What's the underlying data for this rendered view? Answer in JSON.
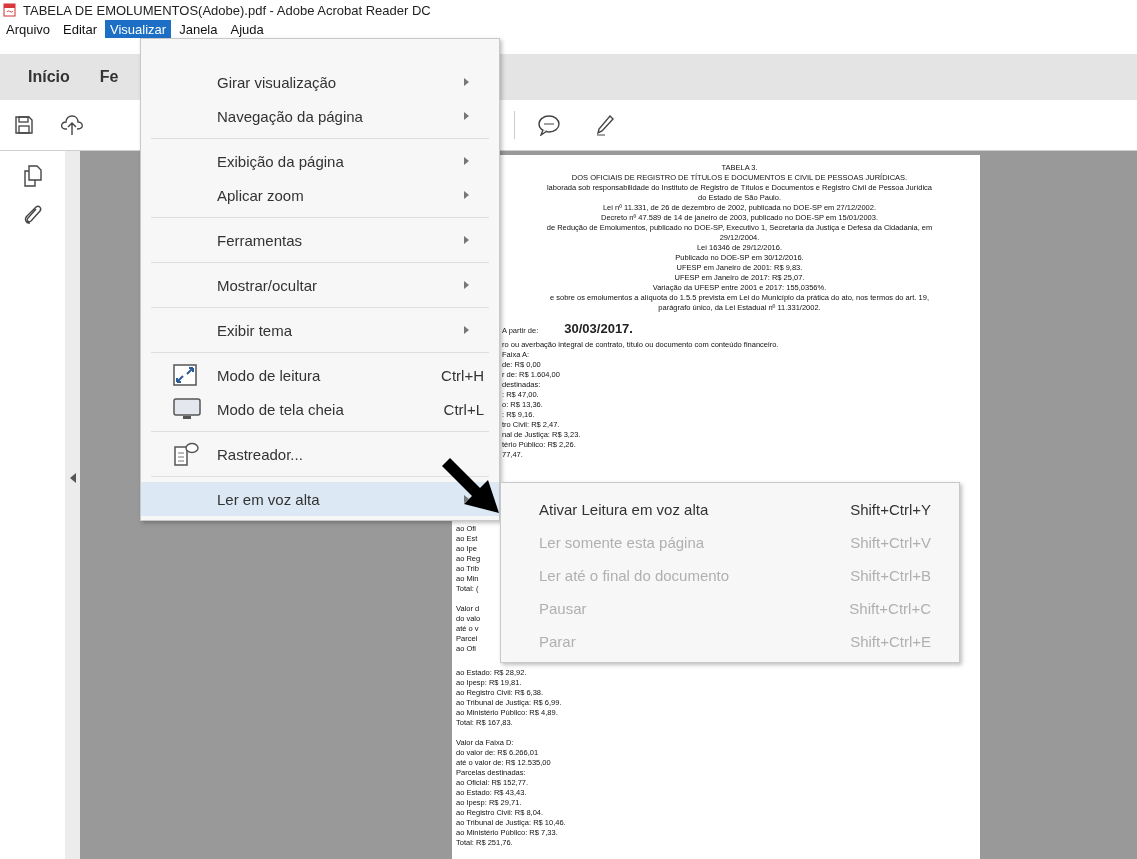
{
  "window": {
    "title": "TABELA DE EMOLUMENTOS(Adobe).pdf - Adobe Acrobat Reader DC"
  },
  "menu_bar": [
    {
      "label": "Arquivo",
      "selected": false
    },
    {
      "label": "Editar",
      "selected": false
    },
    {
      "label": "Visualizar",
      "selected": true
    },
    {
      "label": "Janela",
      "selected": false
    },
    {
      "label": "Ajuda",
      "selected": false
    }
  ],
  "tabs": [
    {
      "label": "Início"
    },
    {
      "label": "Fe"
    }
  ],
  "view_menu": {
    "groups": [
      {
        "items": [
          {
            "label": "Girar visualização",
            "kind": "submenu",
            "selected": false
          },
          {
            "label": "Navegação da página",
            "kind": "submenu",
            "selected": false
          }
        ]
      },
      {
        "items": [
          {
            "label": "Exibição da página",
            "kind": "submenu",
            "selected": false
          },
          {
            "label": "Aplicar zoom",
            "kind": "submenu",
            "selected": false
          }
        ]
      },
      {
        "items": [
          {
            "label": "Ferramentas",
            "kind": "submenu",
            "selected": false
          }
        ]
      },
      {
        "items": [
          {
            "label": "Mostrar/ocultar",
            "kind": "submenu",
            "selected": false
          }
        ]
      },
      {
        "items": [
          {
            "label": "Exibir tema",
            "kind": "submenu",
            "selected": false
          }
        ]
      },
      {
        "items": [
          {
            "label": "Modo de leitura",
            "kind": "command",
            "shortcut": "Ctrl+H",
            "selected": false
          },
          {
            "label": "Modo de tela cheia",
            "kind": "command",
            "shortcut": "Ctrl+L",
            "selected": false
          }
        ]
      },
      {
        "items": [
          {
            "label": "Rastreador...",
            "kind": "command",
            "selected": false
          }
        ]
      },
      {
        "items": [
          {
            "label": "Ler em voz alta",
            "kind": "submenu",
            "selected": true
          }
        ]
      }
    ]
  },
  "read_aloud_submenu": [
    {
      "label": "Ativar Leitura em voz alta",
      "shortcut": "Shift+Ctrl+Y",
      "disabled": false
    },
    {
      "label": "Ler somente esta página",
      "shortcut": "Shift+Ctrl+V",
      "disabled": true
    },
    {
      "label": "Ler até o final do documento",
      "shortcut": "Shift+Ctrl+B",
      "disabled": true
    },
    {
      "label": "Pausar",
      "shortcut": "Shift+Ctrl+C",
      "disabled": true
    },
    {
      "label": "Parar",
      "shortcut": "Shift+Ctrl+E",
      "disabled": true
    }
  ],
  "document_page": {
    "header_lines": [
      "TABELA 3.",
      "DOS OFICIAIS DE REGISTRO DE TÍTULOS E DOCUMENTOS E CIVIL DE PESSOAS JURÍDICAS.",
      "laborada sob responsabilidade do Instituto de Registro de Títulos e Documentos e Registro Civil de Pessoa Jurídica",
      "do Estado de São Paulo.",
      "Lei nº 11.331, de 26 de dezembro de 2002, publicada no DOE-SP em 27/12/2002.",
      "Decreto nº 47.589 de 14 de janeiro de 2003, publicado no DOE-SP em 15/01/2003.",
      "de Redução de Emolumentos, publicado no DOE-SP, Executivo 1, Secretaria da Justiça e Defesa da Cidadania, em",
      "29/12/2004.",
      "Lei 16346 de 29/12/2016.",
      "Publicado no DOE-SP em 30/12/2016.",
      "UFESP em Janeiro de 2001: R$ 9,83.",
      "UFESP em Janeiro de 2017: R$ 25,07.",
      "Variação da UFESP entre 2001 e 2017: 155,0356%.",
      "e sobre os emolumentos a alíquota do 1.5.5 prevista em Lei do Município da prática do ato, nos termos do art. 19,",
      "parágrafo único, da Lei Estadual nº 11.331/2002."
    ],
    "effective_label": "A partir de:",
    "effective_date": "30/03/2017.",
    "body_lines": [
      "ro ou averbação integral de contrato, título ou documento com conteúdo financeiro.",
      "Faixa A:",
      "de: R$ 0,00",
      "r de: R$ 1.604,00",
      "destinadas:",
      ": R$ 47,00.",
      "o: R$ 13,36.",
      ": R$ 9,16.",
      "tro Civil: R$ 2,47.",
      "nal de Justiça: R$ 3,23.",
      "tério Público: R$ 2,26.",
      "77,47."
    ],
    "partial_blocks": [
      {
        "lines": [
          "ao Ofi",
          "ao Est",
          "ao Ipe",
          "ao Reg",
          "ao Trib",
          "ao Min",
          "Total: ("
        ]
      },
      {
        "lines": [
          "Valor d",
          "do valo",
          "até o v",
          "Parcel",
          "ao Ofi"
        ]
      }
    ],
    "lower_blocks": [
      {
        "lines": [
          "ao Estado: R$ 28,92.",
          "ao Ipesp: R$ 19,81.",
          "ao Registro Civil: R$ 6,38.",
          "ao Tribunal de Justiça: R$ 6,99.",
          "ao Ministério Público: R$ 4,89.",
          "Total: R$ 167,83."
        ]
      },
      {
        "lines": [
          "Valor da Faixa D:",
          "do valor de: R$ 6.266,01",
          "até o valor de: R$ 12.535,00",
          "Parcelas destinadas:",
          "ao Oficial: R$ 152,77.",
          "ao Estado: R$ 43,43.",
          "ao Ipesp: R$ 29,71.",
          "ao Registro Civil: R$ 8,04.",
          "ao Tribunal de Justiça: R$ 10,46.",
          "ao Ministério Público: R$ 7,33.",
          "Total: R$ 251,76."
        ]
      }
    ]
  }
}
